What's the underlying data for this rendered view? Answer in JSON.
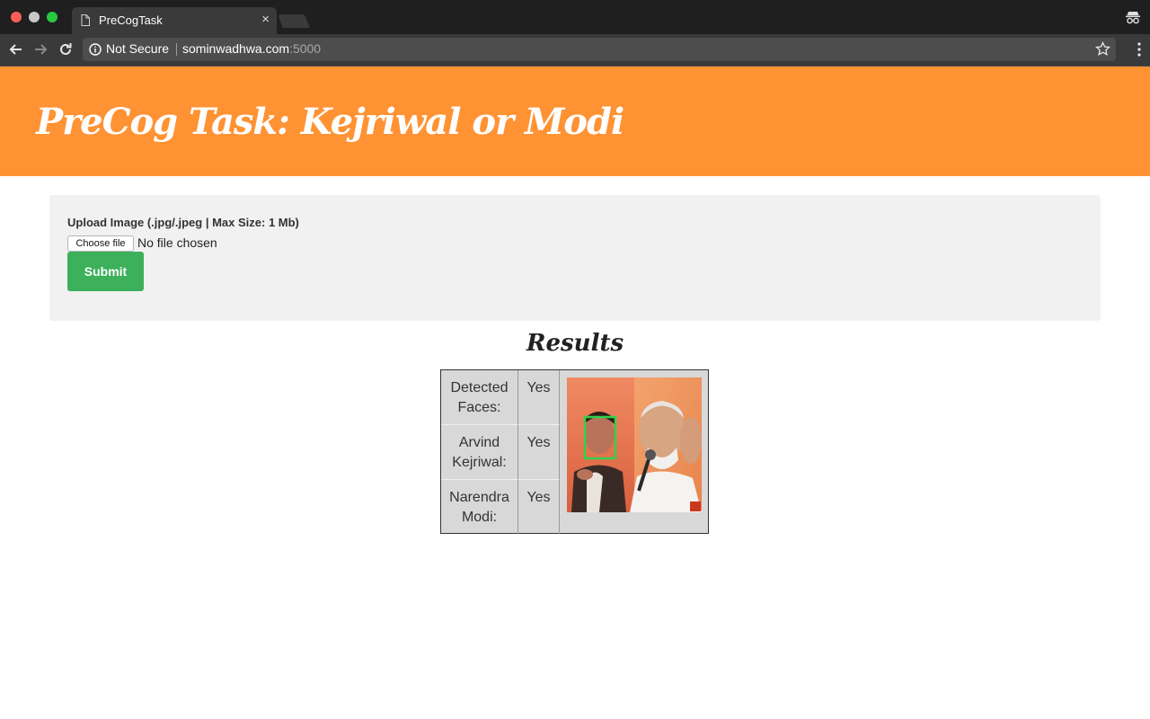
{
  "browser": {
    "tab_title": "PreCogTask",
    "close_glyph": "×",
    "security_label": "Not Secure",
    "url_host": "sominwadhwa.com",
    "url_port": ":5000"
  },
  "header": {
    "title": "PreCog Task: Kejriwal or Modi",
    "background": "#ff9233"
  },
  "upload": {
    "label": "Upload Image (.jpg/.jpeg | Max Size: 1 Mb)",
    "choose_file": "Choose file",
    "file_status": "No file chosen",
    "submit": "Submit",
    "submit_color": "#3cb05a"
  },
  "results": {
    "title": "Results",
    "rows": [
      {
        "label": "Detected Faces:",
        "value": "Yes"
      },
      {
        "label": "Arvind Kejriwal:",
        "value": "Yes"
      },
      {
        "label": "Narendra Modi:",
        "value": "Yes"
      }
    ],
    "image_icon": "detected-face-photo",
    "face_box_color": "#33d14a"
  }
}
